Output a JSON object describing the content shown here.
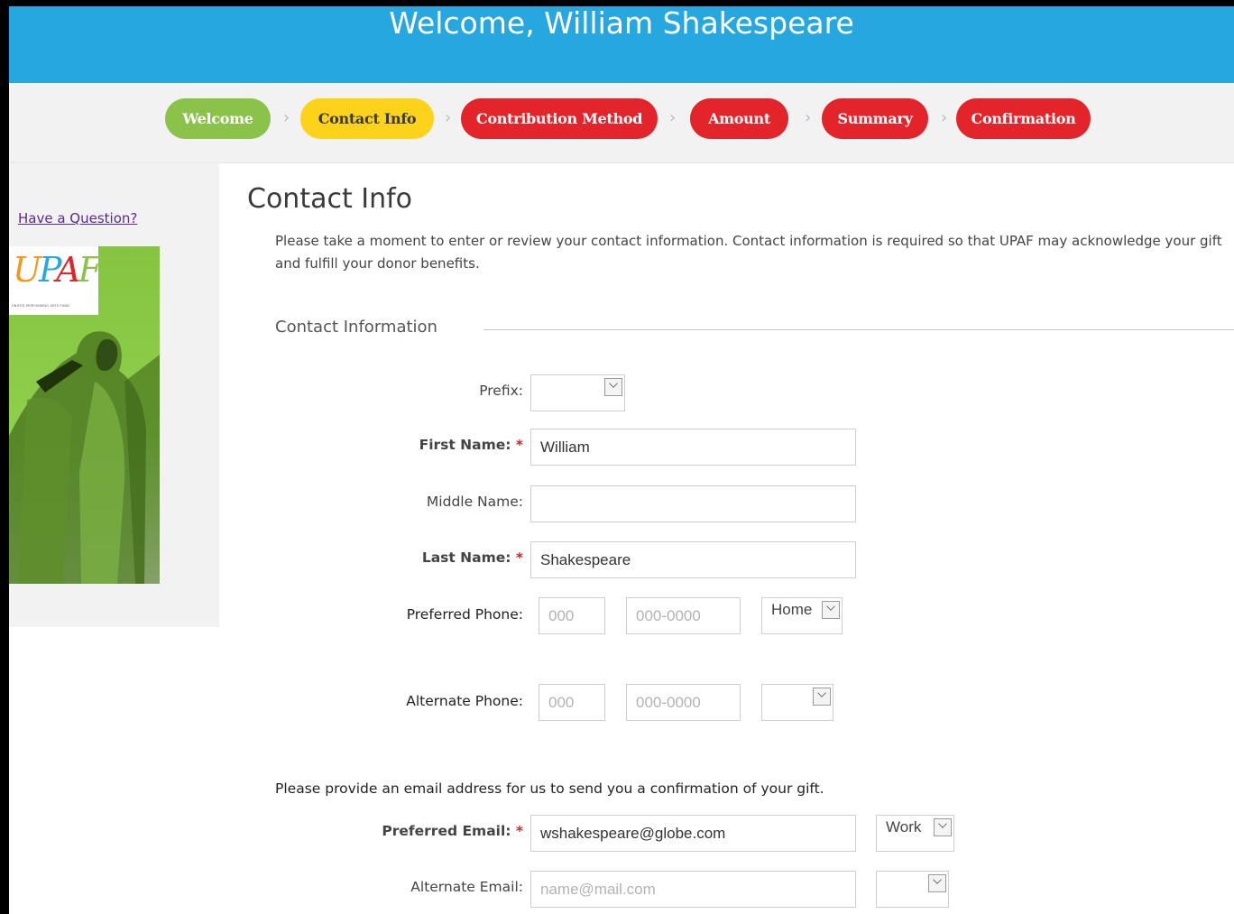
{
  "header": {
    "title": "Welcome, William Shakespeare",
    "bg_color": "#27a7df"
  },
  "steps": [
    {
      "label": "Welcome",
      "color": "#8bc34a"
    },
    {
      "label": "Contact Info",
      "color": "#fcd21b",
      "text_color": "#3a3a3a"
    },
    {
      "label": "Contribution Method",
      "color": "#e3242b"
    },
    {
      "label": "Amount",
      "color": "#e3242b"
    },
    {
      "label": "Summary",
      "color": "#e3242b"
    },
    {
      "label": "Confirmation",
      "color": "#e3242b"
    }
  ],
  "sidebar": {
    "question_link": "Have a Question?",
    "logo_text": "UPAF",
    "logo_caption": "UNITED PERFORMING ARTS FUND"
  },
  "main": {
    "title": "Contact Info",
    "intro": "Please take a moment to enter or review your contact information. Contact information is required so that UPAF may acknowledge your gift and fulfill your donor benefits.",
    "section_title": "Contact Information",
    "email_note": "Please provide an email address for us to send you a confirmation of your gift."
  },
  "form": {
    "prefix": {
      "label": "Prefix:",
      "value": ""
    },
    "first_name": {
      "label": "First Name:",
      "value": "William"
    },
    "middle_name": {
      "label": "Middle Name:",
      "value": ""
    },
    "last_name": {
      "label": "Last Name:",
      "value": "Shakespeare"
    },
    "preferred_phone": {
      "label": "Preferred Phone:",
      "area_placeholder": "000",
      "number_placeholder": "000-0000",
      "type": "Home"
    },
    "alternate_phone": {
      "label": "Alternate Phone:",
      "area_placeholder": "000",
      "number_placeholder": "000-0000",
      "type": ""
    },
    "preferred_email": {
      "label": "Preferred Email:",
      "value": "wshakespeare@globe.com",
      "type": "Work"
    },
    "alternate_email": {
      "label": "Alternate Email:",
      "placeholder": "name@mail.com",
      "type": ""
    },
    "required_marker": "*"
  }
}
